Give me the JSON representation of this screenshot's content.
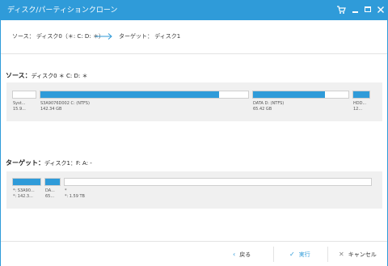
{
  "window": {
    "title": "ディスク/パーティションクローン"
  },
  "header": {
    "source_text": "ソース： ディスク0（＊: C: D: ＊）",
    "target_text": "ターゲット： ディスク1"
  },
  "source": {
    "label_bold": "ソース：",
    "label_rest": "ディスク0 ＊ C: D: ＊",
    "partitions": [
      {
        "name": "Syst...",
        "size": "15.9...",
        "used_fraction": 0.0
      },
      {
        "name": "S3A9076D002 C: (NTFS)",
        "size": "142.34 GB",
        "used_fraction": 0.86
      },
      {
        "name": "DATA D: (NTFS)",
        "size": "65.42 GB",
        "used_fraction": 0.75
      },
      {
        "name": "HDD...",
        "size": "12...",
        "used_fraction": 1.0
      }
    ]
  },
  "target": {
    "label_bold": "ターゲット：",
    "label_rest": "ディスク1：F: A: -",
    "partitions": [
      {
        "name": "*: S3A90...",
        "size": "*: 142.3...",
        "used_fraction": 1.0
      },
      {
        "name": "DA...",
        "size": "65...",
        "used_fraction": 1.0
      },
      {
        "name": "*",
        "size": "*: 1.59 TB",
        "used_fraction": 0.0
      }
    ]
  },
  "footer": {
    "back_label": "戻る",
    "run_label": "実行",
    "cancel_label": "キャンセル"
  },
  "colors": {
    "accent": "#2f9bd9"
  }
}
